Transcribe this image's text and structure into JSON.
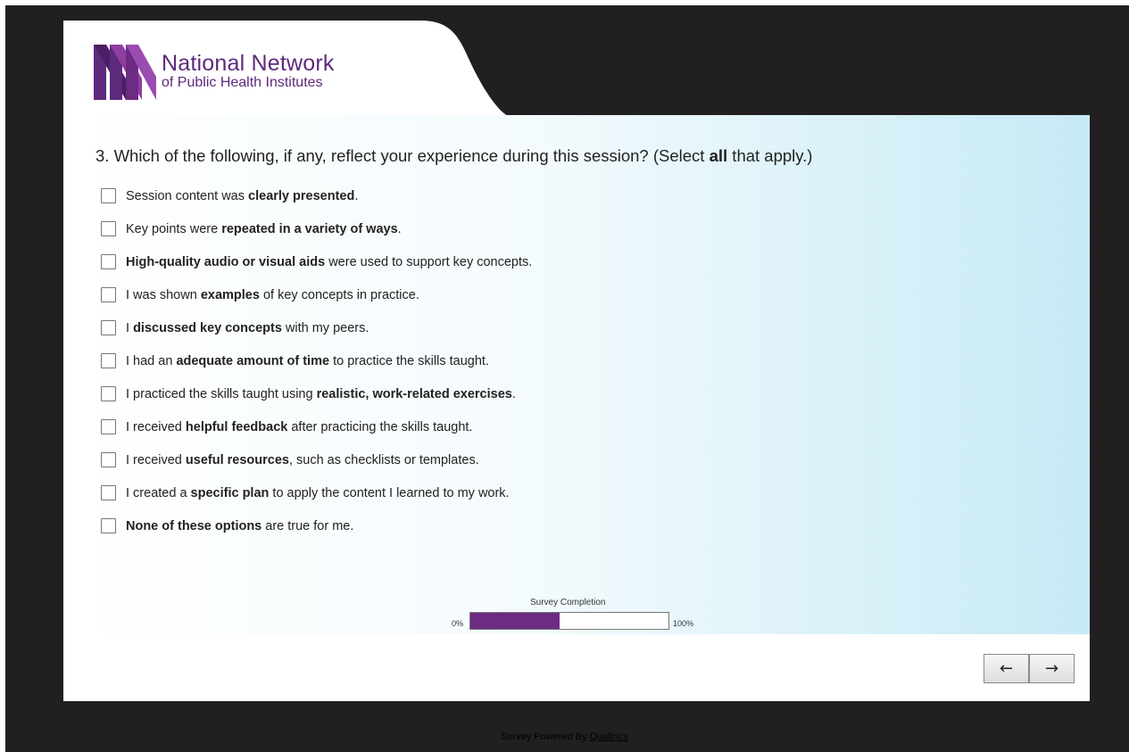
{
  "brand": {
    "title": "National Network",
    "subtitle": "of Public Health Institutes",
    "color": "#5e2a7c"
  },
  "question": {
    "prefix": "3. Which of the following, if any, reflect your experience during this session? (Select ",
    "bold": "all",
    "suffix": " that apply.)"
  },
  "options": [
    {
      "pre": "Session content was ",
      "bold": "clearly presented",
      "post": ".",
      "checked": false
    },
    {
      "pre": "Key points were ",
      "bold": "repeated in a variety of ways",
      "post": ".",
      "checked": false
    },
    {
      "pre": "",
      "bold": "High-quality audio or visual aids",
      "post": " were used to support key concepts.",
      "checked": false
    },
    {
      "pre": "I was shown ",
      "bold": "examples",
      "post": " of key concepts in practice.",
      "checked": false
    },
    {
      "pre": "I ",
      "bold": "discussed key concepts",
      "post": " with my peers.",
      "checked": false
    },
    {
      "pre": "I had an ",
      "bold": "adequate amount of time",
      "post": " to practice the skills taught.",
      "checked": false
    },
    {
      "pre": "I practiced the skills taught using ",
      "bold": "realistic, work-related exercises",
      "post": ".",
      "checked": false
    },
    {
      "pre": "I received ",
      "bold": "helpful feedback",
      "post": " after practicing the skills taught.",
      "checked": false
    },
    {
      "pre": "I received ",
      "bold": "useful resources",
      "post": ", such as checklists or templates.",
      "checked": false
    },
    {
      "pre": "I created a ",
      "bold": "specific plan",
      "post": " to apply the content I learned to my work.",
      "checked": false
    },
    {
      "pre": "",
      "bold": "None of these options",
      "post": " are true for me.",
      "checked": false
    }
  ],
  "progress": {
    "title": "Survey Completion",
    "min_label": "0%",
    "max_label": "100%",
    "value_percent": 45,
    "fill_color": "#6d2b83"
  },
  "nav": {
    "back_label": "←",
    "next_label": "→"
  },
  "footer": {
    "text": "Survey Powered By ",
    "link": "Qualtrics"
  }
}
